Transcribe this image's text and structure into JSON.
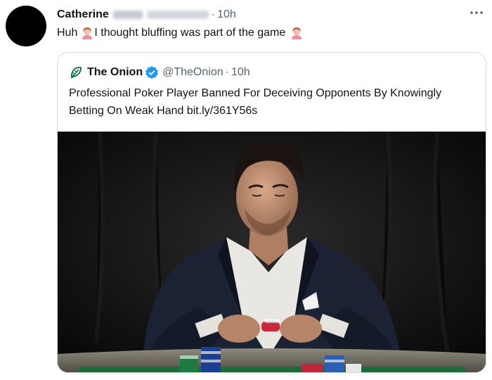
{
  "tweet": {
    "display_name": "Catherine",
    "time": "10h",
    "dot": "·",
    "text_part1": "Huh",
    "text_part2": "I thought bluffing was part of the game",
    "emoji_icon": "person-facepalming-emoji",
    "more_icon": "more-options-icon"
  },
  "quote": {
    "logo_icon": "onion-leaf-logo",
    "name": "The Onion",
    "verified_icon": "verified-badge-icon",
    "handle": "@TheOnion",
    "dot": "·",
    "time": "10h",
    "text": "Professional Poker Player Banned For Deceiving Opponents By Knowingly Betting On Weak Hand bit.ly/361Y56s",
    "media_alt": "young man in dark suit at a poker table holding cards and chips against a black background"
  },
  "colors": {
    "text_primary": "#0f1419",
    "text_secondary": "#536471",
    "verified_blue": "#1d9bf0",
    "border": "#cfd9de",
    "onion_green": "#006f3c"
  }
}
